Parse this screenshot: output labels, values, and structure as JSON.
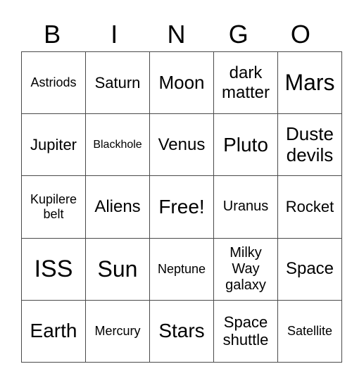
{
  "header": [
    "B",
    "I",
    "N",
    "G",
    "O"
  ],
  "rows": [
    [
      "Astriods",
      "Saturn",
      "Moon",
      "dark matter",
      "Mars"
    ],
    [
      "Jupiter",
      "Blackhole",
      "Venus",
      "Pluto",
      "Duste devils"
    ],
    [
      "Kupilere belt",
      "Aliens",
      "Free!",
      "Uranus",
      "Rocket"
    ],
    [
      "ISS",
      "Sun",
      "Neptune",
      "Milky Way galaxy",
      "Space"
    ],
    [
      "Earth",
      "Mercury",
      "Stars",
      "Space shuttle",
      "Satellite"
    ]
  ]
}
